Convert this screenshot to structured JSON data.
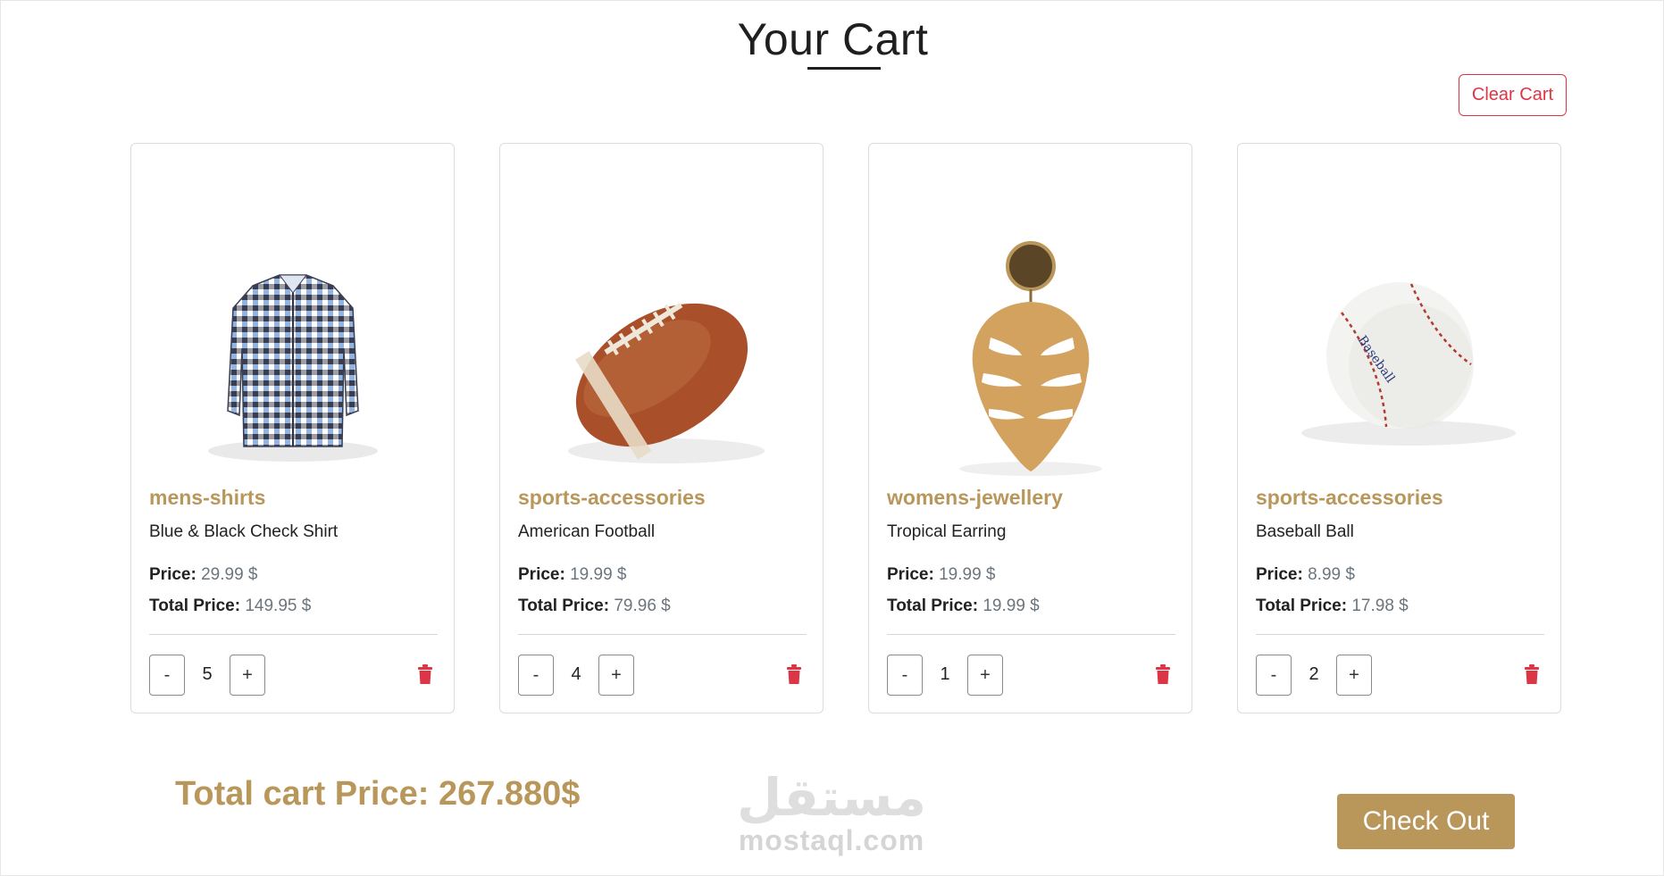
{
  "header": {
    "title": "Your Cart",
    "clear_label": "Clear Cart"
  },
  "products": [
    {
      "category": "mens-shirts",
      "name": "Blue & Black Check Shirt",
      "price_label": "Price:",
      "price": "29.99 $",
      "total_label": "Total Price:",
      "total": "149.95 $",
      "quantity": "5",
      "image": "shirt-image"
    },
    {
      "category": "sports-accessories",
      "name": "American Football",
      "price_label": "Price:",
      "price": "19.99 $",
      "total_label": "Total Price:",
      "total": "79.96 $",
      "quantity": "4",
      "image": "football-image"
    },
    {
      "category": "womens-jewellery",
      "name": "Tropical Earring",
      "price_label": "Price:",
      "price": "19.99 $",
      "total_label": "Total Price:",
      "total": "19.99 $",
      "quantity": "1",
      "image": "earring-image"
    },
    {
      "category": "sports-accessories",
      "name": "Baseball Ball",
      "price_label": "Price:",
      "price": "8.99 $",
      "total_label": "Total Price:",
      "total": "17.98 $",
      "quantity": "2",
      "image": "baseball-image"
    }
  ],
  "controls": {
    "minus": "-",
    "plus": "+"
  },
  "footer": {
    "total_text": "Total cart Price: 267.880$",
    "checkout_label": "Check Out"
  },
  "watermark": {
    "arabic": "مستقل",
    "latin": "mostaql.com"
  },
  "colors": {
    "accent": "#b9975b",
    "danger": "#dc3545",
    "muted": "#6c757d"
  }
}
